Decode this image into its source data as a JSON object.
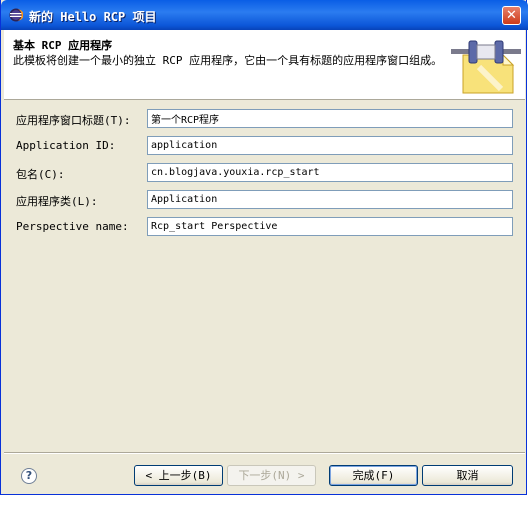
{
  "window": {
    "title": "新的 Hello RCP 项目"
  },
  "banner": {
    "title": "基本 RCP 应用程序",
    "description": "此模板将创建一个最小的独立 RCP 应用程序，它由一个具有标题的应用程序窗口组成。"
  },
  "form": {
    "fields": [
      {
        "label": "应用程序窗口标题(T):",
        "value": "第一个RCP程序"
      },
      {
        "label": "Application ID:",
        "value": "application"
      },
      {
        "label": "包名(C):",
        "value": "cn.blogjava.youxia.rcp_start"
      },
      {
        "label": "应用程序类(L):",
        "value": "Application"
      },
      {
        "label": "Perspective name:",
        "value": "Rcp_start Perspective"
      }
    ]
  },
  "buttons": {
    "back": "< 上一步(B)",
    "next": "下一步(N) >",
    "finish": "完成(F)",
    "cancel": "取消"
  },
  "icons": {
    "window": "eclipse-icon",
    "help": "help-icon",
    "close": "close-icon",
    "banner": "plugin-wizard-icon"
  },
  "colors": {
    "titlebar": "#0a5ee6",
    "dialog_bg": "#ece9d8",
    "close": "#cd3b1a"
  }
}
